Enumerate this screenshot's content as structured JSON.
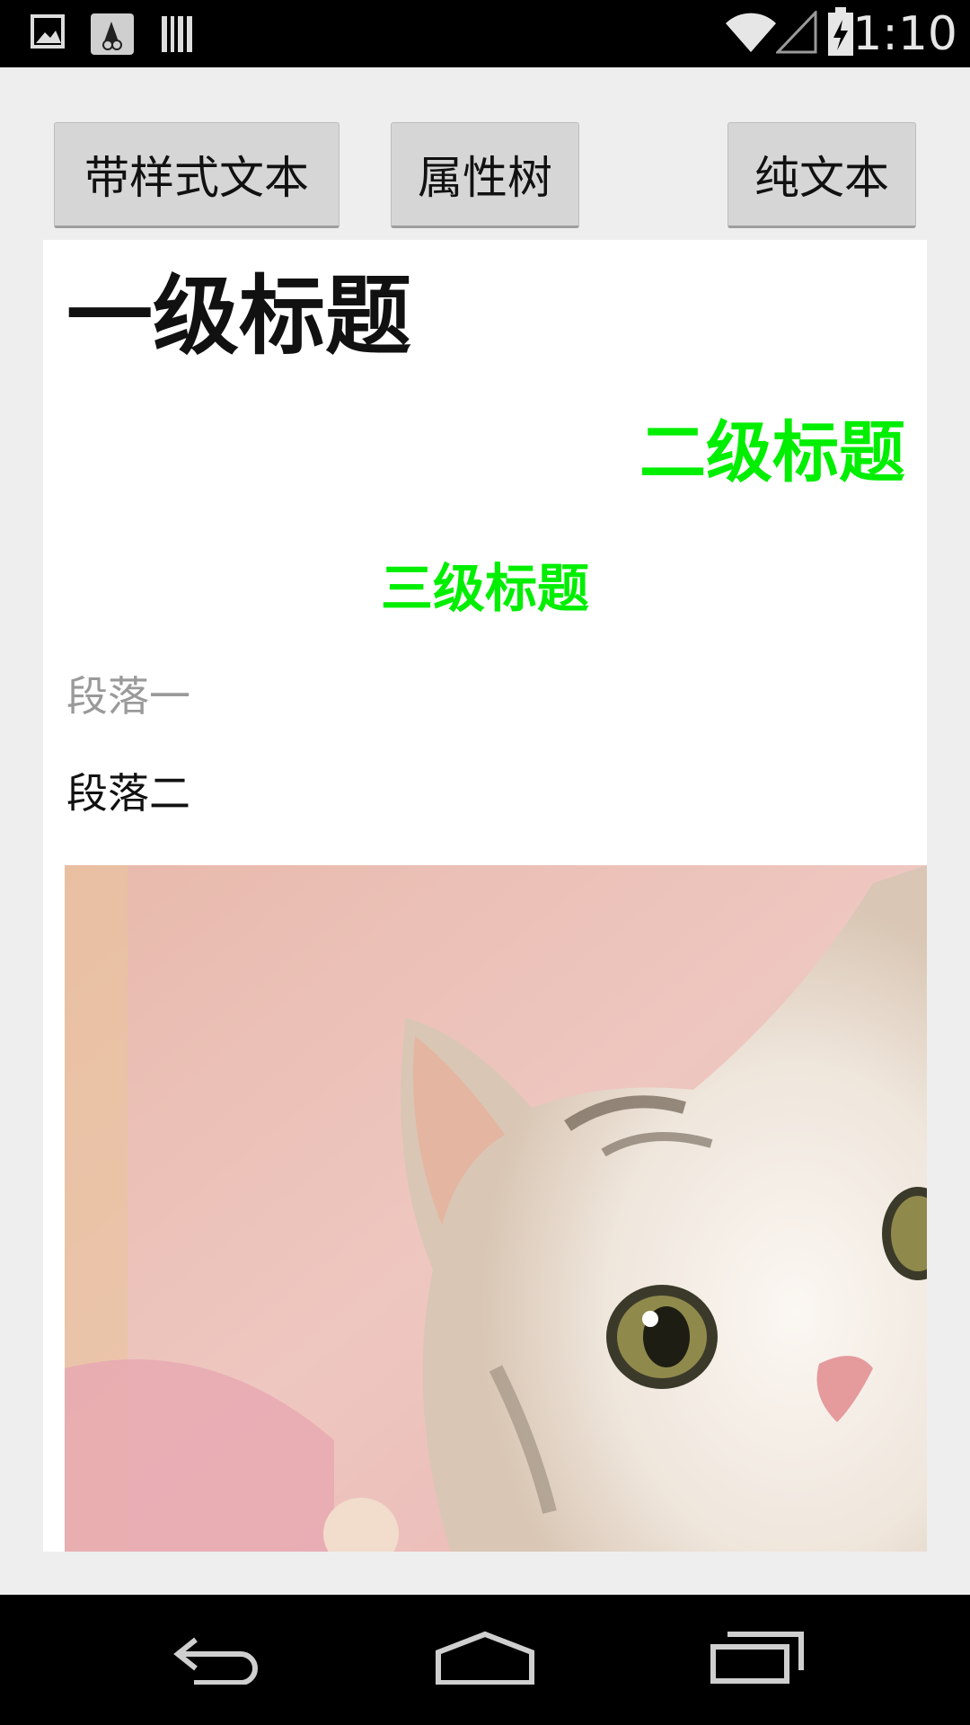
{
  "status_bar": {
    "time": "1:10",
    "icons": [
      "image-icon",
      "app-notification-icon",
      "barcode-icon",
      "wifi-icon",
      "signal-icon",
      "battery-charging-icon"
    ]
  },
  "toolbar": {
    "styled_text_label": "带样式文本",
    "attribute_tree_label": "属性树",
    "plain_text_label": "纯文本"
  },
  "content": {
    "heading1": "一级标题",
    "heading2": "二级标题",
    "heading3": "三级标题",
    "paragraph1": "段落一",
    "paragraph2": "段落二",
    "heading_color": "#00ee00",
    "muted_color": "#9a9a9a"
  },
  "nav_bar": {
    "icons": [
      "back-icon",
      "home-icon",
      "recents-icon"
    ]
  }
}
